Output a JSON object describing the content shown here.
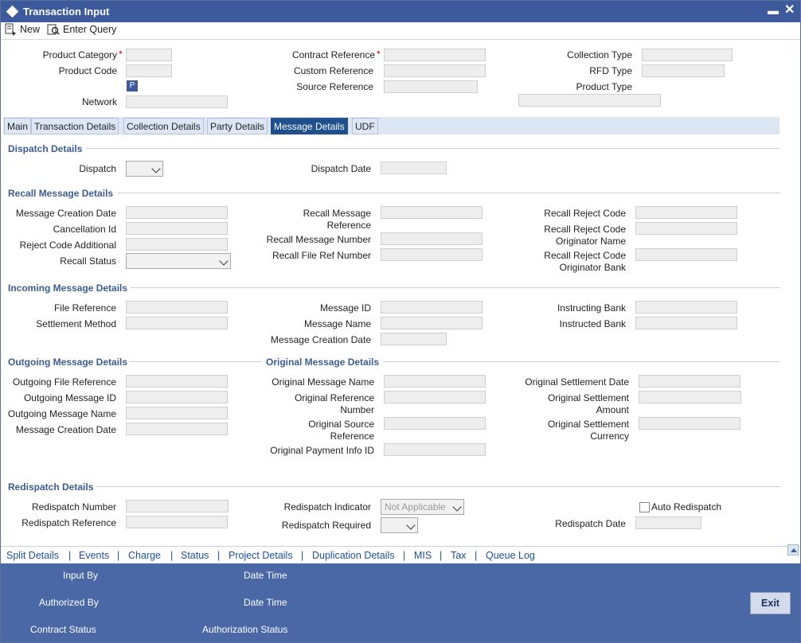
{
  "window": {
    "title": "Transaction Input",
    "minimize": "▬",
    "close": "✕"
  },
  "toolbar": {
    "new_label": "New",
    "enter_query_label": "Enter Query"
  },
  "header": {
    "product_category": "Product Category",
    "product_code": "Product Code",
    "p_button": "P",
    "network": "Network",
    "contract_reference": "Contract Reference",
    "custom_reference": "Custom Reference",
    "source_reference": "Source Reference",
    "collection_type": "Collection Type",
    "rfd_type": "RFD Type",
    "product_type": "Product Type",
    "required_mark": "*"
  },
  "tabs": [
    "Main",
    "Transaction Details",
    "Collection Details",
    "Party Details",
    "Message Details",
    "UDF"
  ],
  "dispatch": {
    "section": "Dispatch Details",
    "dispatch": "Dispatch",
    "dispatch_date": "Dispatch Date"
  },
  "recall": {
    "section": "Recall Message Details",
    "message_creation_date": "Message Creation Date",
    "cancellation_id": "Cancellation Id",
    "reject_code_additional": "Reject Code Additional",
    "recall_status": "Recall Status",
    "recall_message_reference_1": "Recall Message",
    "recall_message_reference_2": "Reference",
    "recall_message_number": "Recall Message Number",
    "recall_file_ref_number": "Recall File Ref Number",
    "recall_reject_code": "Recall Reject Code",
    "orig_name_1": "Recall Reject Code",
    "orig_name_2": "Originator Name",
    "orig_bank_1": "Recall Reject Code",
    "orig_bank_2": "Originator Bank"
  },
  "incoming": {
    "section": "Incoming Message Details",
    "file_reference": "File Reference",
    "settlement_method": "Settlement Method",
    "message_id": "Message ID",
    "message_name": "Message Name",
    "message_creation_date": "Message Creation Date",
    "instructing_bank": "Instructing Bank",
    "instructed_bank": "Instructed Bank"
  },
  "outgoing": {
    "section": "Outgoing Message Details",
    "file_reference": "Outgoing File Reference",
    "message_id": "Outgoing Message ID",
    "message_name": "Outgoing Message Name",
    "message_creation_date": "Message Creation Date"
  },
  "original": {
    "section": "Original Message Details",
    "message_name": "Original Message Name",
    "ref_number_1": "Original Reference",
    "ref_number_2": "Number",
    "source_ref_1": "Original Source",
    "source_ref_2": "Reference",
    "payment_info_id": "Original Payment Info ID",
    "settlement_date": "Original Settlement Date",
    "settle_amount_1": "Original Settlement",
    "settle_amount_2": "Amount",
    "settle_currency_1": "Original Settlement",
    "settle_currency_2": "Currency"
  },
  "redispatch": {
    "section": "Redispatch Details",
    "number": "Redispatch Number",
    "reference": "Redispatch Reference",
    "indicator": "Redispatch Indicator",
    "indicator_value": "Not Applicable",
    "required": "Redispatch Required",
    "auto": "Auto Redispatch",
    "date": "Redispatch Date"
  },
  "links": [
    "Split Details",
    "Events",
    "Charge",
    "Status",
    "Project Details",
    "Duplication Details",
    "MIS",
    "Tax",
    "Queue Log"
  ],
  "link_separator": "|",
  "footer": {
    "input_by": "Input By",
    "date_time_1": "Date Time",
    "authorized_by": "Authorized By",
    "date_time_2": "Date Time",
    "contract_status": "Contract Status",
    "authorization_status": "Authorization Status",
    "exit": "Exit"
  },
  "colors": {
    "title_bar": "#3d5a9c",
    "footer": "#4a67a6",
    "section_title": "#3c5c91",
    "link": "#1d4f9c",
    "active_tab": "#1f4f8c"
  }
}
